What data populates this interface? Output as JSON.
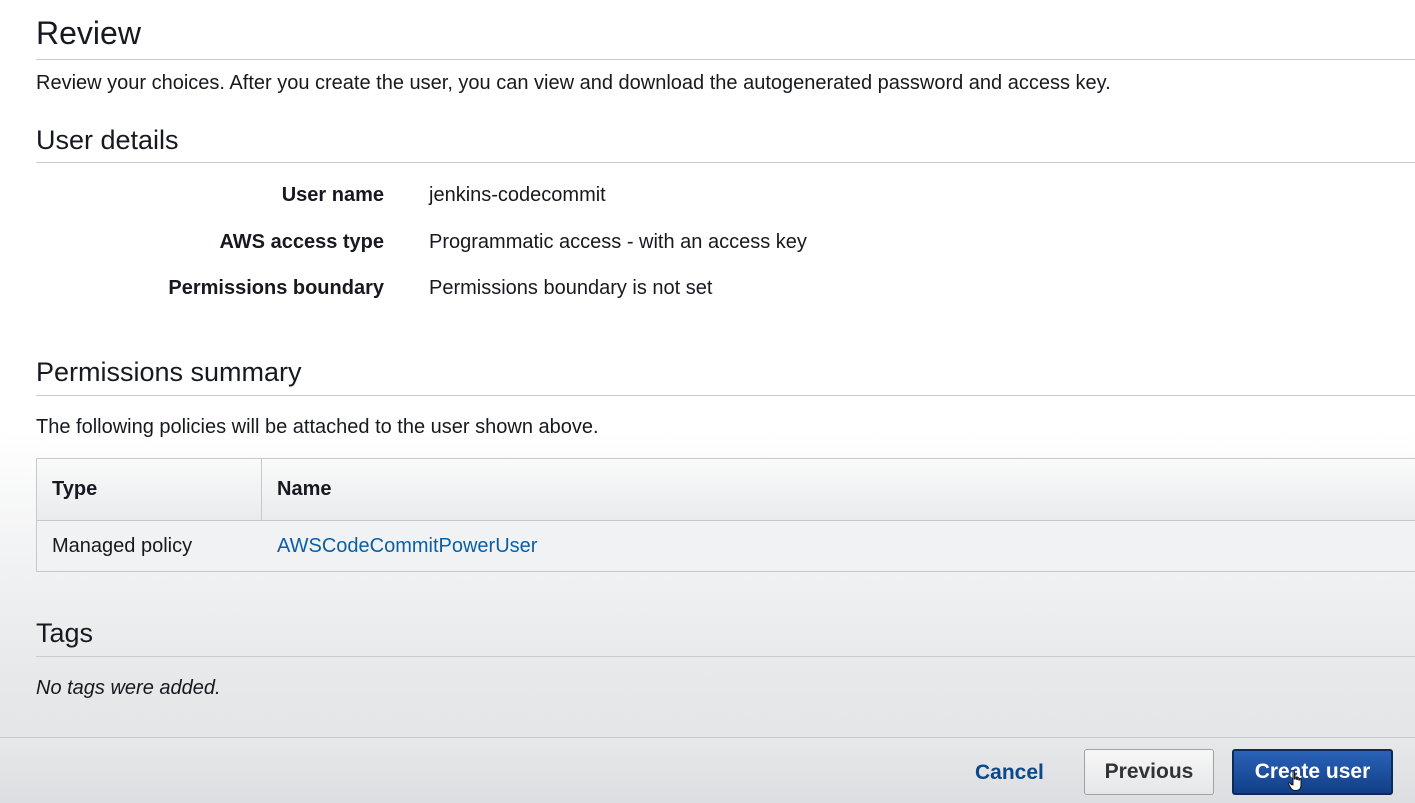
{
  "review": {
    "title": "Review",
    "intro": "Review your choices. After you create the user, you can view and download the autogenerated password and access key."
  },
  "user_details": {
    "title": "User details",
    "rows": [
      {
        "label": "User name",
        "value": "jenkins-codecommit"
      },
      {
        "label": "AWS access type",
        "value": "Programmatic access - with an access key"
      },
      {
        "label": "Permissions boundary",
        "value": "Permissions boundary is not set"
      }
    ]
  },
  "permissions_summary": {
    "title": "Permissions summary",
    "description": "The following policies will be attached to the user shown above.",
    "columns": [
      "Type",
      "Name"
    ],
    "rows": [
      {
        "type": "Managed policy",
        "name": "AWSCodeCommitPowerUser"
      }
    ]
  },
  "tags": {
    "title": "Tags",
    "empty_message": "No tags were added."
  },
  "footer": {
    "cancel_label": "Cancel",
    "previous_label": "Previous",
    "create_label": "Create user"
  },
  "colors": {
    "link": "#0b5fa5",
    "primary_button": "#1f4f9c",
    "cancel_link": "#0a4a8a"
  },
  "icons": {
    "cursor": "hand-pointer-icon"
  }
}
